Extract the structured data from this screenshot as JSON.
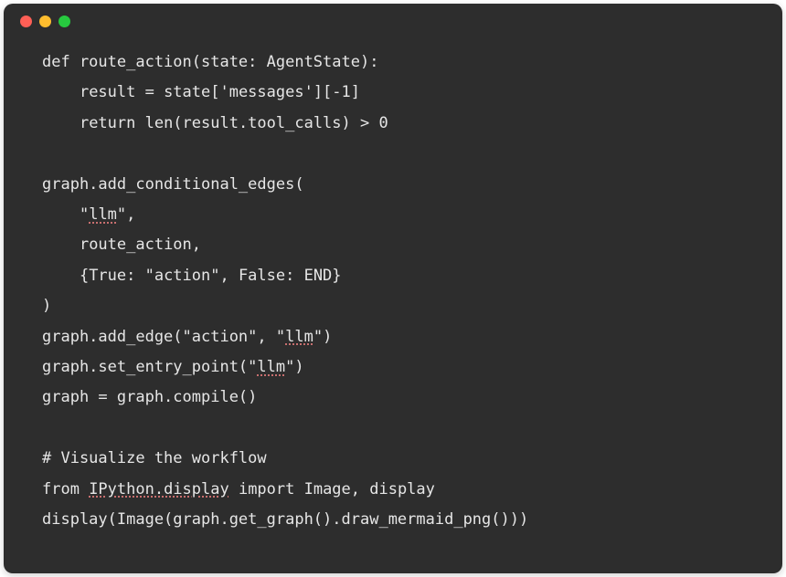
{
  "window": {
    "trafficLights": [
      "red",
      "yellow",
      "green"
    ]
  },
  "code": {
    "line1": "def route_action(state: AgentState):",
    "line2_indent": "    ",
    "line2": "result = state['messages'][-1]",
    "line3_indent": "    ",
    "line3": "return len(result.tool_calls) > 0",
    "line4": "",
    "line5": "graph.add_conditional_edges(",
    "line6_indent": "    ",
    "line6a": "\"",
    "line6b_underlined": "llm",
    "line6c": "\",",
    "line7_indent": "    ",
    "line7": "route_action,",
    "line8_indent": "    ",
    "line8": "{True: \"action\", False: END}",
    "line9": ")",
    "line10a": "graph.add_edge(\"action\", \"",
    "line10b_underlined": "llm",
    "line10c": "\")",
    "line11a": "graph.set_entry_point(\"",
    "line11b_underlined": "llm",
    "line11c": "\")",
    "line12": "graph = graph.compile()",
    "line13": "",
    "line14": "# Visualize the workflow",
    "line15a": "from ",
    "line15b_underlined": "IPython.display",
    "line15c": " import Image, display",
    "line16": "display(Image(graph.get_graph().draw_mermaid_png()))"
  }
}
